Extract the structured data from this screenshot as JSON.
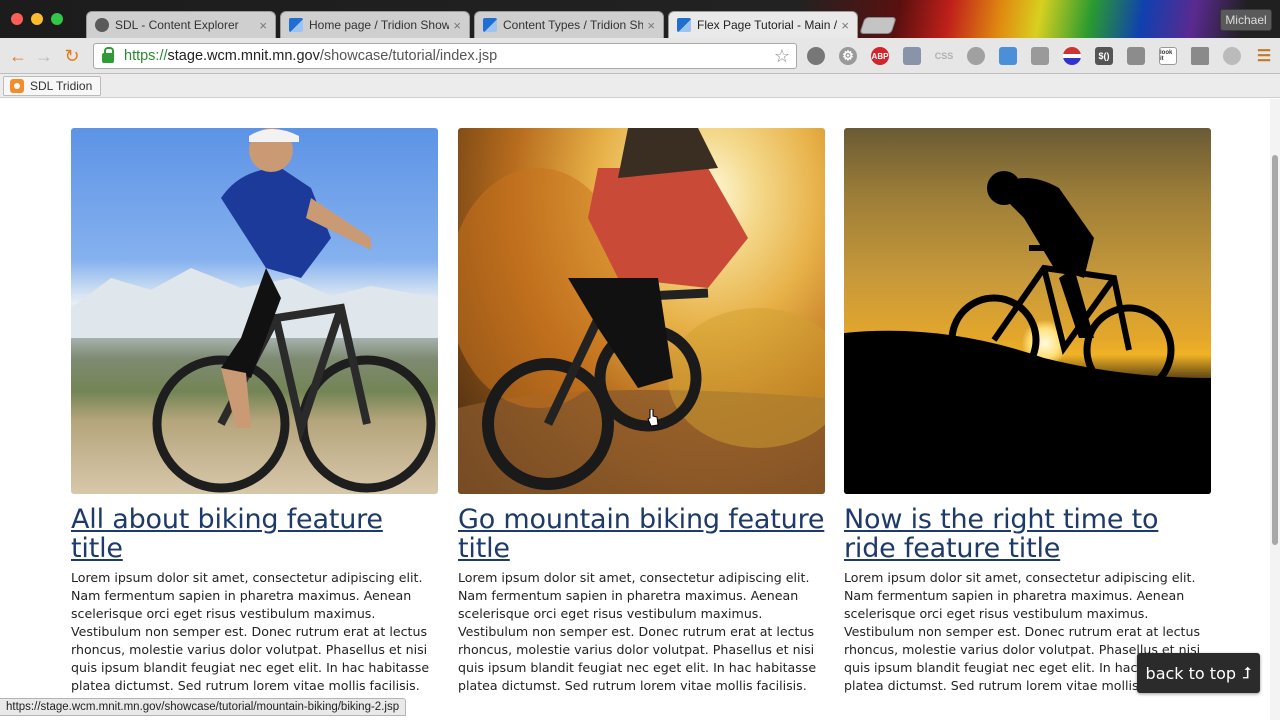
{
  "browser": {
    "tabs": [
      {
        "title": "SDL - Content Explorer",
        "favicon": "sdl-icon",
        "active": false
      },
      {
        "title": "Home page / Tridion Show",
        "favicon": "page-icon",
        "active": false
      },
      {
        "title": "Content Types / Tridion Sh",
        "favicon": "page-icon",
        "active": false
      },
      {
        "title": "Flex Page Tutorial - Main /",
        "favicon": "page-icon",
        "active": true
      }
    ],
    "tab_close_glyph": "×",
    "profile_name": "Michael",
    "url_scheme": "https://",
    "url_host": "stage.wcm.mnit.mn.gov",
    "url_path": "/showcase/tutorial/index.jsp",
    "extensions": {
      "abp": "ABP",
      "css": "CSS",
      "jquery": "$()",
      "lookit": "look it"
    },
    "bookmarks": [
      {
        "label": "SDL Tridion",
        "icon": "sdl-tridion-icon"
      }
    ],
    "status_url": "https://stage.wcm.mnit.mn.gov/showcase/tutorial/mountain-biking/biking-2.jsp"
  },
  "features": [
    {
      "title": "All about biking feature title",
      "body": "Lorem ipsum dolor sit amet, consectetur adipiscing elit. Nam fermentum sapien in pharetra maximus. Aenean scelerisque orci eget risus vestibulum maximus. Vestibulum non semper est. Donec rutrum erat at lectus rhoncus, molestie varius dolor volutpat. Phasellus et nisi quis ipsum blandit feugiat nec eget elit. In hac habitasse platea dictumst. Sed rutrum lorem vitae mollis facilisis.",
      "image": "cyclist-mountain-road-photo"
    },
    {
      "title": "Go mountain biking feature title",
      "body": "Lorem ipsum dolor sit amet, consectetur adipiscing elit. Nam fermentum sapien in pharetra maximus. Aenean scelerisque orci eget risus vestibulum maximus. Vestibulum non semper est. Donec rutrum erat at lectus rhoncus, molestie varius dolor volutpat. Phasellus et nisi quis ipsum blandit feugiat nec eget elit. In hac habitasse platea dictumst. Sed rutrum lorem vitae mollis facilisis.",
      "image": "mountain-biker-autumn-trail-photo"
    },
    {
      "title": "Now is the right time to ride feature title",
      "body": "Lorem ipsum dolor sit amet, consectetur adipiscing elit. Nam fermentum sapien in pharetra maximus. Aenean scelerisque orci eget risus vestibulum maximus. Vestibulum non semper est. Donec rutrum erat at lectus rhoncus, molestie varius dolor volutpat. Phasellus et nisi quis ipsum blandit feugiat nec eget elit. In hac habitasse platea dictumst. Sed rutrum lorem vitae mollis facilisis.",
      "image": "cyclist-sunset-silhouette-photo"
    }
  ],
  "back_to_top": {
    "label": "back to top",
    "glyph": "⮥"
  },
  "colors": {
    "link": "#1d3a6b",
    "secure_url": "#2a8a2f",
    "button_bg": "#2b2b2b"
  }
}
